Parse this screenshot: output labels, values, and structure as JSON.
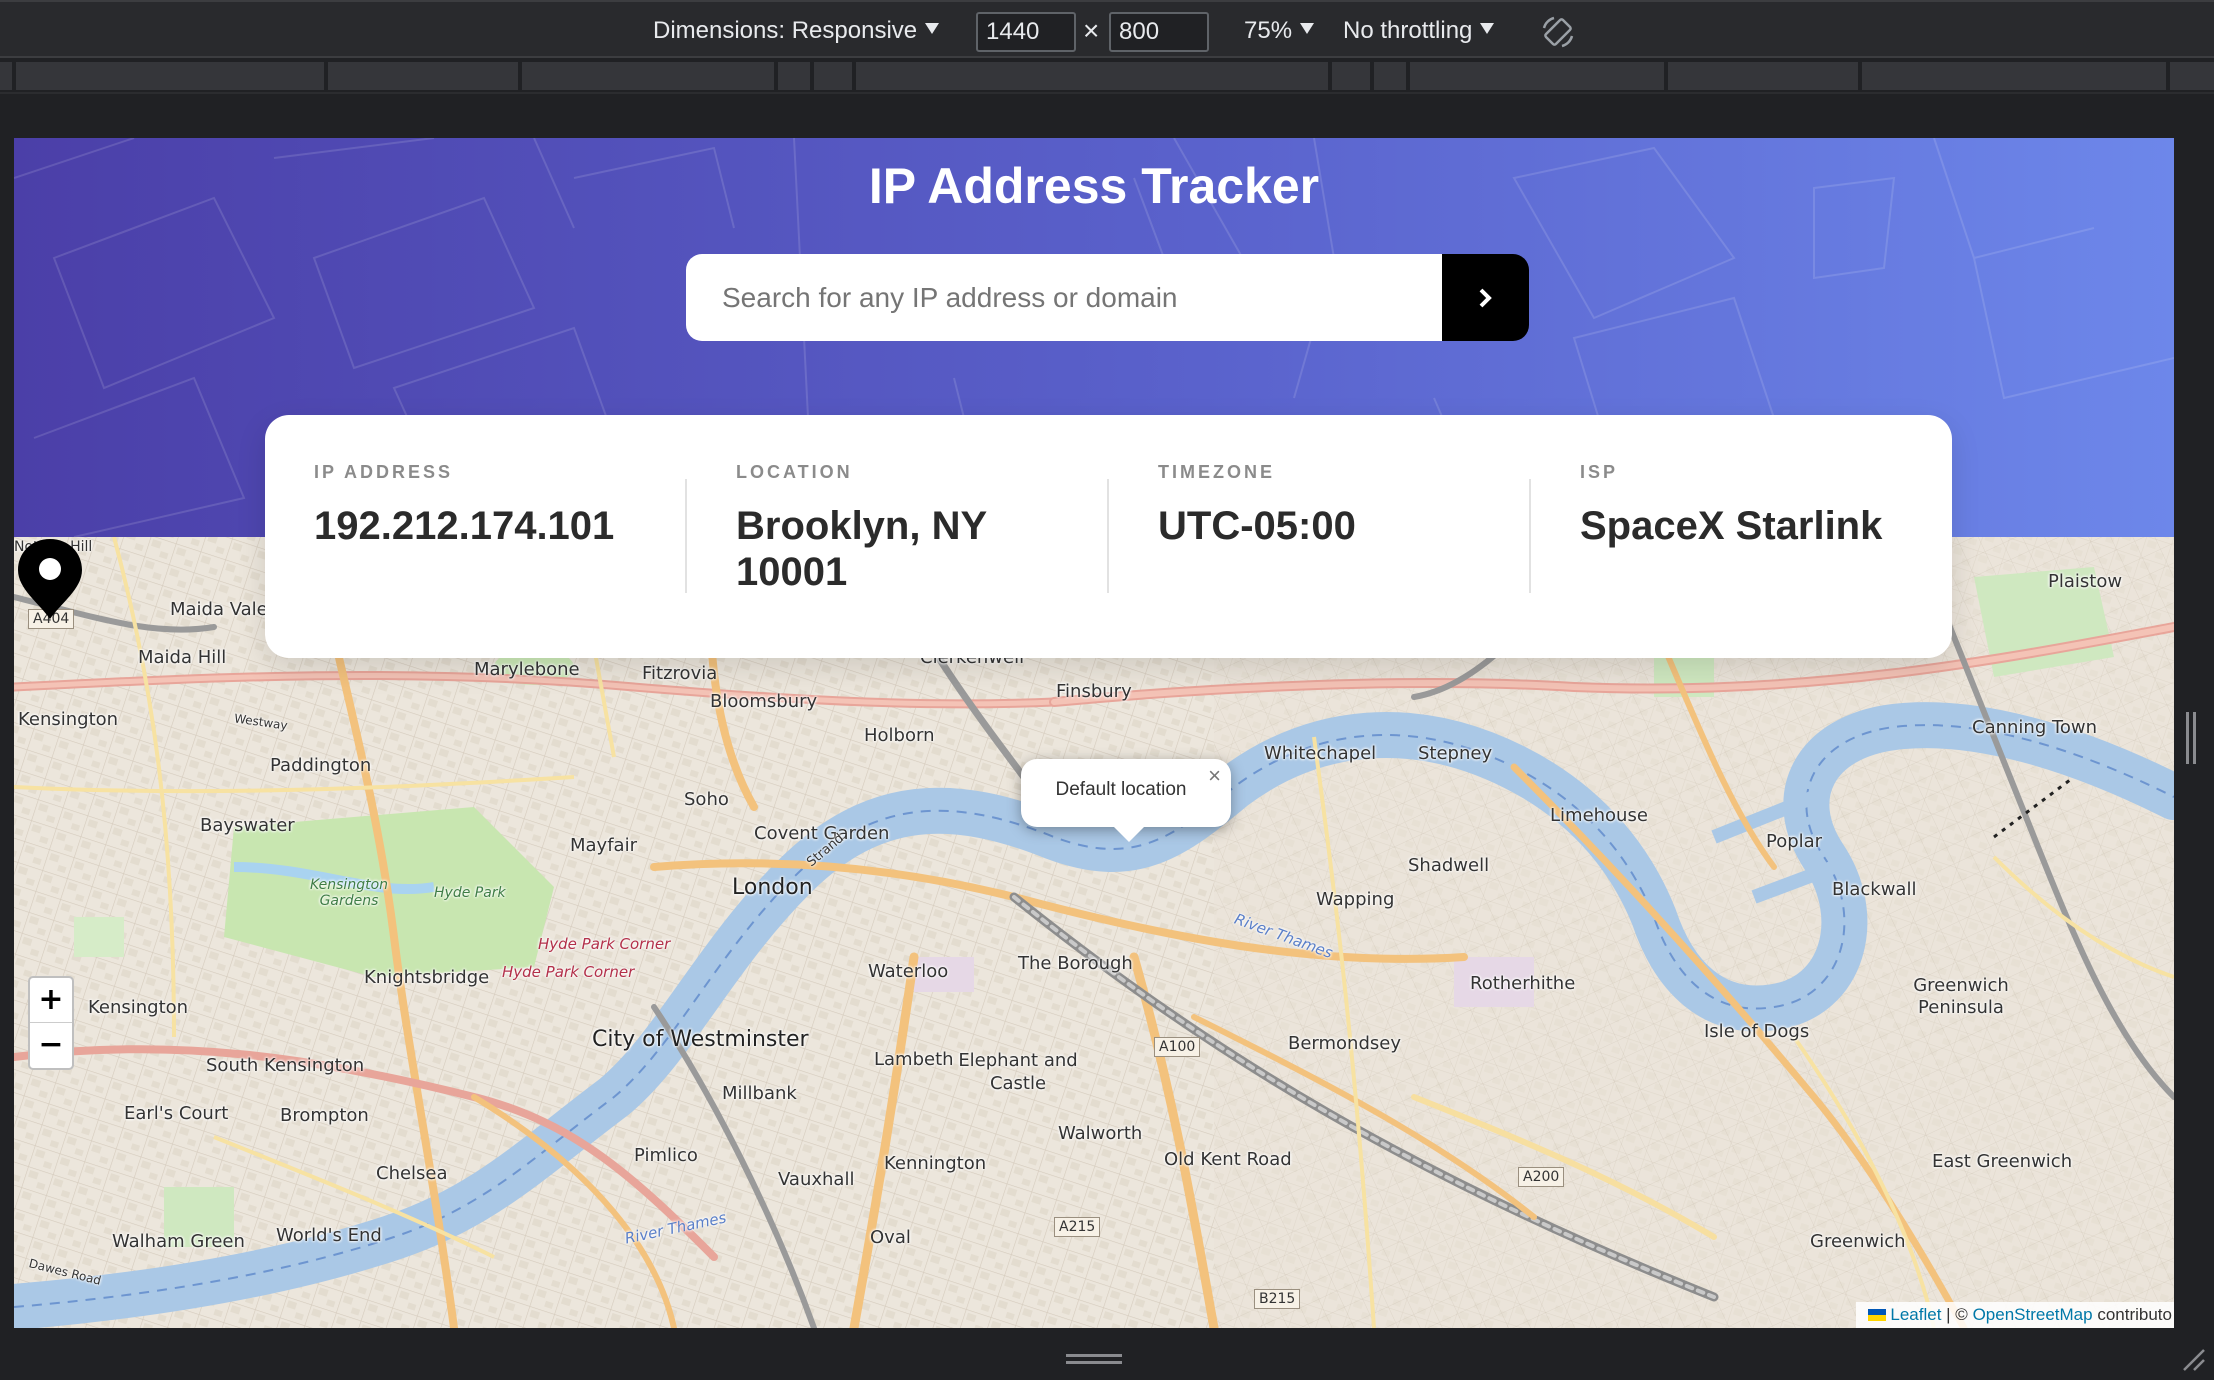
{
  "devtools": {
    "dimensions_label": "Dimensions: Responsive",
    "width_value": "1440",
    "times_symbol": "×",
    "height_value": "800",
    "zoom_label": "75%",
    "throttle_label": "No throttling",
    "rotate_icon": "rotate-icon"
  },
  "header": {
    "title": "IP Address Tracker"
  },
  "search": {
    "placeholder": "Search for any IP address or domain",
    "value": "",
    "button_icon": "chevron-right-icon"
  },
  "info": [
    {
      "label": "IP ADDRESS",
      "value": "192.212.174.101"
    },
    {
      "label": "LOCATION",
      "value": "Brooklyn, NY 10001"
    },
    {
      "label": "TIMEZONE",
      "value": "UTC-05:00"
    },
    {
      "label": "ISP",
      "value": "SpaceX Starlink"
    }
  ],
  "map": {
    "popup_text": "Default location",
    "popup_close": "×",
    "zoom_in": "+",
    "zoom_out": "−",
    "marker_icon": "location-pin-icon",
    "attribution": {
      "leaflet": "Leaflet",
      "separator": "| ©",
      "osm": "OpenStreetMap",
      "suffix": "contributo"
    },
    "places": {
      "maida_vale": "Maida Vale",
      "maida_hill": "Maida Hill",
      "kensington_nw": "Kensington",
      "paddington": "Paddington",
      "bayswater": "Bayswater",
      "notting_hill": "Notting Hill",
      "marylebone": "Marylebone",
      "fitzrovia": "Fitzrovia",
      "bloomsbury": "Bloomsbury",
      "clerkenwell": "Clerkenwell",
      "finsbury": "Finsbury",
      "holborn": "Holborn",
      "soho": "Soho",
      "mayfair": "Mayfair",
      "covent_garden": "Covent Garden",
      "london": "London",
      "whitechapel": "Whitechapel",
      "stepney": "Stepney",
      "limehouse": "Limehouse",
      "shadwell": "Shadwell",
      "wapping": "Wapping",
      "poplar": "Poplar",
      "blackwall": "Blackwall",
      "canning_town": "Canning Town",
      "plaistow": "Plaistow",
      "knightsbridge": "Knightsbridge",
      "kensington": "Kensington",
      "south_kensington": "South Kensington",
      "earls_court": "Earl's Court",
      "brompton": "Brompton",
      "chelsea": "Chelsea",
      "walham_green": "Walham Green",
      "worlds_end": "World's End",
      "city_of_westminster": "City of Westminster",
      "lambeth": "Lambeth",
      "millbank": "Millbank",
      "pimlico": "Pimlico",
      "vauxhall": "Vauxhall",
      "kennington": "Kennington",
      "oval": "Oval",
      "waterloo": "Waterloo",
      "the_borough": "The Borough",
      "elephant_and_castle": "Elephant and Castle",
      "walworth": "Walworth",
      "old_kent_road": "Old Kent Road",
      "bermondsey": "Bermondsey",
      "rotherhithe": "Rotherhithe",
      "isle_of_dogs": "Isle of Dogs",
      "greenwich_peninsula": "Greenwich Peninsula",
      "east_greenwich": "East Greenwich",
      "greenwich": "Greenwich",
      "kensington_gardens": "Kensington Gardens",
      "hyde_park": "Hyde Park",
      "hyde_park_corner_1": "Hyde Park Corner",
      "hyde_park_corner_2": "Hyde Park Corner",
      "river_thames_1": "River Thames",
      "river_thames_2": "River Thames",
      "strand": "Strand",
      "westway": "Westway",
      "dawes_road": "Dawes Road"
    },
    "shields": {
      "a404": "A404",
      "a100": "A100",
      "a215": "A215",
      "b215": "B215",
      "a200": "A200"
    }
  },
  "colors": {
    "hero_start": "#4b3fa8",
    "hero_end": "#6d87ea",
    "button_bg": "#000000",
    "label_gray": "#8b8b8b",
    "value_dark": "#2b2b2b",
    "thames": "#aac8e6",
    "park_green": "#c8e6b0",
    "link": "#0078a8"
  }
}
